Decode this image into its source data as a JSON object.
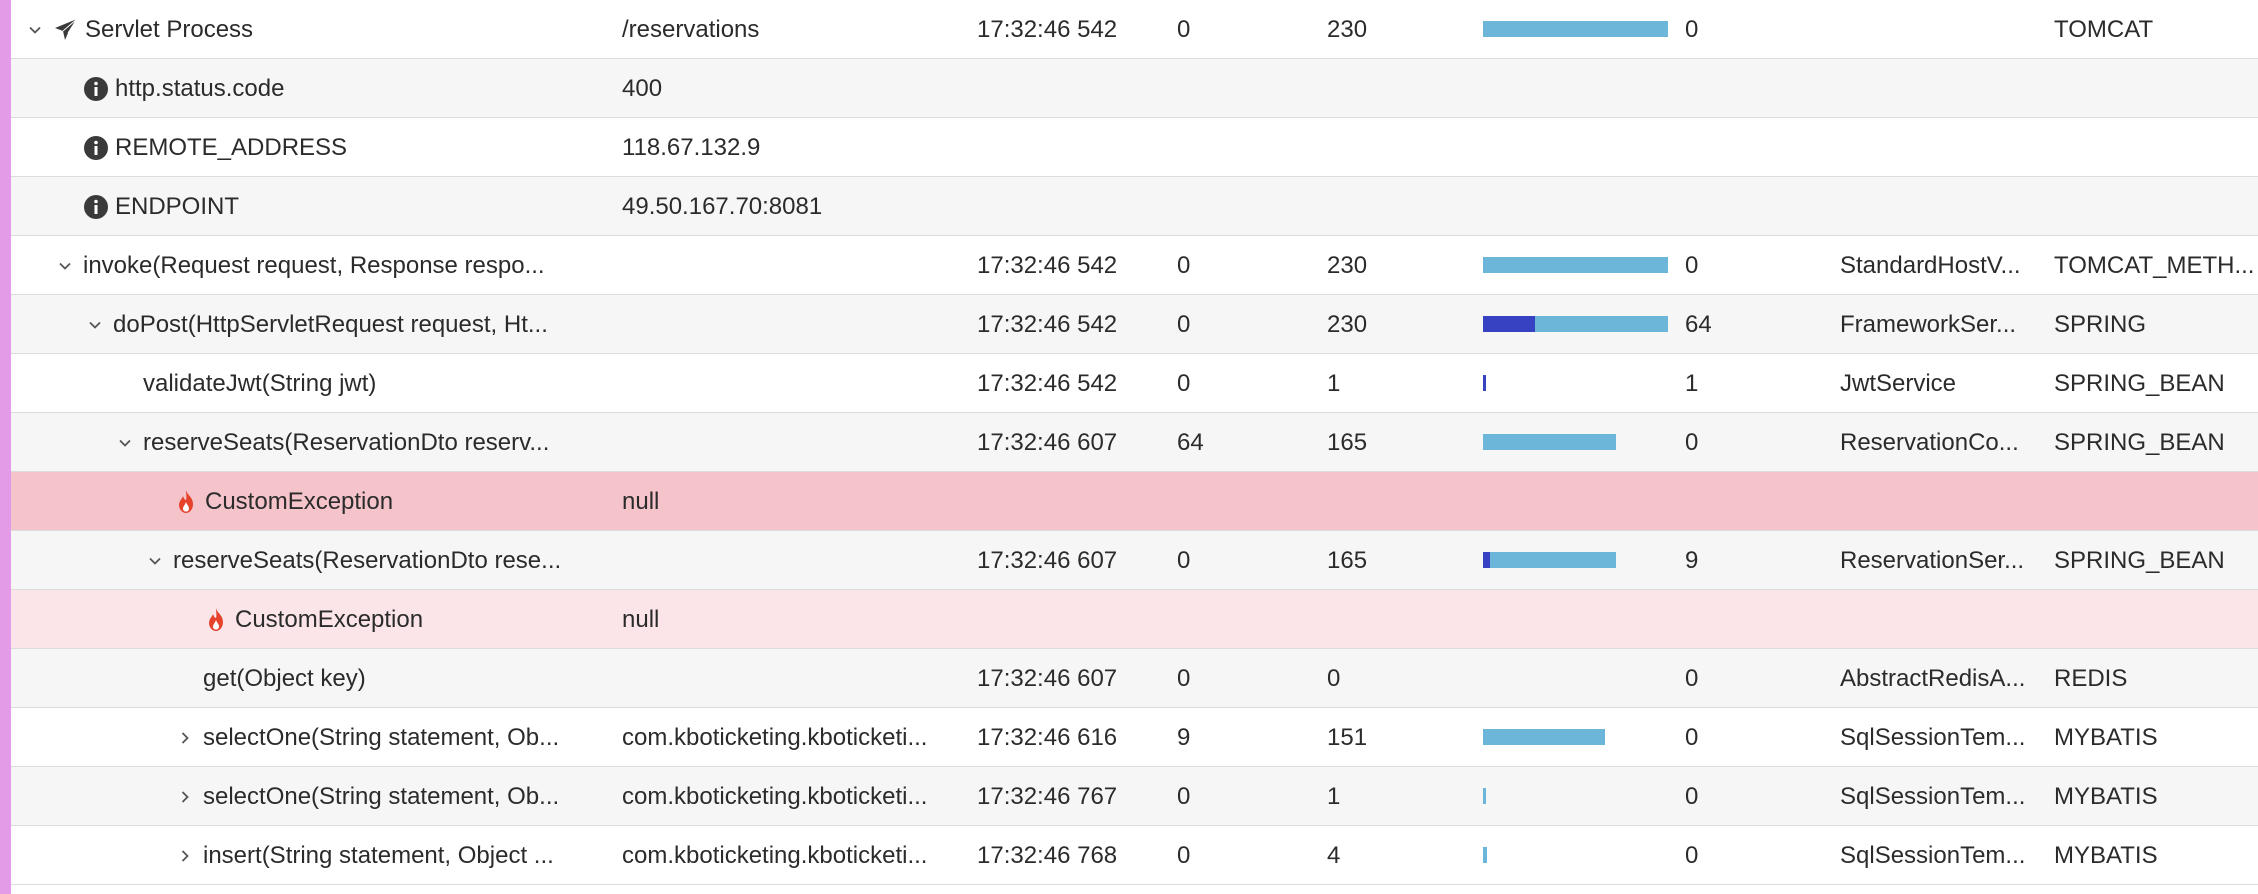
{
  "colors": {
    "left_stripe": "#e39be7",
    "bar": "#6cb6da",
    "bar_self": "#3742c2",
    "error_row": "#f5c4ca",
    "error_row_light": "#fbe5e8",
    "flame_icon": "#e5432b"
  },
  "rows": [
    {
      "name": "Servlet Process",
      "expander": "expanded",
      "icon": "paper-plane-icon",
      "depth": 0,
      "arg": "/reservations",
      "start": "17:32:46 542",
      "gap": "0",
      "elapsed": "230",
      "bar_pct": 100,
      "self_pct": 0,
      "self": "0",
      "class": "",
      "type": "TOMCAT",
      "style": "white"
    },
    {
      "name": "http.status.code",
      "expander": "none",
      "icon": "info-icon",
      "depth": 1,
      "arg": "400",
      "start": "",
      "gap": "",
      "elapsed": "",
      "bar_pct": null,
      "self_pct": null,
      "self": "",
      "class": "",
      "type": "",
      "style": "gray"
    },
    {
      "name": "REMOTE_ADDRESS",
      "expander": "none",
      "icon": "info-icon",
      "depth": 1,
      "arg": "118.67.132.9",
      "start": "",
      "gap": "",
      "elapsed": "",
      "bar_pct": null,
      "self_pct": null,
      "self": "",
      "class": "",
      "type": "",
      "style": "white"
    },
    {
      "name": "ENDPOINT",
      "expander": "none",
      "icon": "info-icon",
      "depth": 1,
      "arg": "49.50.167.70:8081",
      "start": "",
      "gap": "",
      "elapsed": "",
      "bar_pct": null,
      "self_pct": null,
      "self": "",
      "class": "",
      "type": "",
      "style": "gray"
    },
    {
      "name": "invoke(Request request, Response respo...",
      "expander": "expanded",
      "icon": "",
      "depth": 1,
      "arg": "",
      "start": "17:32:46 542",
      "gap": "0",
      "elapsed": "230",
      "bar_pct": 100,
      "self_pct": 0,
      "self": "0",
      "class": "StandardHostV...",
      "type": "TOMCAT_METH...",
      "style": "white"
    },
    {
      "name": "doPost(HttpServletRequest request, Ht...",
      "expander": "expanded",
      "icon": "",
      "depth": 2,
      "arg": "",
      "start": "17:32:46 542",
      "gap": "0",
      "elapsed": "230",
      "bar_pct": 100,
      "self_pct": 28,
      "self": "64",
      "class": "FrameworkSer...",
      "type": "SPRING",
      "style": "gray"
    },
    {
      "name": "validateJwt(String jwt)",
      "expander": "none",
      "icon": "",
      "depth": 3,
      "arg": "",
      "start": "17:32:46 542",
      "gap": "0",
      "elapsed": "1",
      "bar_pct": 1,
      "self_pct": 1,
      "self": "1",
      "class": "JwtService",
      "type": "SPRING_BEAN",
      "style": "white"
    },
    {
      "name": "reserveSeats(ReservationDto reserv...",
      "expander": "expanded",
      "icon": "",
      "depth": 3,
      "arg": "",
      "start": "17:32:46 607",
      "gap": "64",
      "elapsed": "165",
      "bar_pct": 72,
      "self_pct": 0,
      "self": "0",
      "class": "ReservationCo...",
      "type": "SPRING_BEAN",
      "style": "gray"
    },
    {
      "name": "CustomException",
      "expander": "none",
      "icon": "flame-icon",
      "depth": 4,
      "arg": "null",
      "start": "",
      "gap": "",
      "elapsed": "",
      "bar_pct": null,
      "self_pct": null,
      "self": "",
      "class": "",
      "type": "",
      "style": "err"
    },
    {
      "name": "reserveSeats(ReservationDto rese...",
      "expander": "expanded",
      "icon": "",
      "depth": 4,
      "arg": "",
      "start": "17:32:46 607",
      "gap": "0",
      "elapsed": "165",
      "bar_pct": 72,
      "self_pct": 4,
      "self": "9",
      "class": "ReservationSer...",
      "type": "SPRING_BEAN",
      "style": "gray"
    },
    {
      "name": "CustomException",
      "expander": "none",
      "icon": "flame-icon",
      "depth": 5,
      "arg": "null",
      "start": "",
      "gap": "",
      "elapsed": "",
      "bar_pct": null,
      "self_pct": null,
      "self": "",
      "class": "",
      "type": "",
      "style": "errlight"
    },
    {
      "name": "get(Object key)",
      "expander": "none",
      "icon": "",
      "depth": 5,
      "arg": "",
      "start": "17:32:46 607",
      "gap": "0",
      "elapsed": "0",
      "bar_pct": 0,
      "self_pct": 0,
      "self": "0",
      "class": "AbstractRedisA...",
      "type": "REDIS",
      "style": "gray"
    },
    {
      "name": "selectOne(String statement, Ob...",
      "expander": "collapsed",
      "icon": "",
      "depth": 5,
      "arg": "com.kboticketing.kboticketi...",
      "start": "17:32:46 616",
      "gap": "9",
      "elapsed": "151",
      "bar_pct": 66,
      "self_pct": 0,
      "self": "0",
      "class": "SqlSessionTem...",
      "type": "MYBATIS",
      "style": "white"
    },
    {
      "name": "selectOne(String statement, Ob...",
      "expander": "collapsed",
      "icon": "",
      "depth": 5,
      "arg": "com.kboticketing.kboticketi...",
      "start": "17:32:46 767",
      "gap": "0",
      "elapsed": "1",
      "bar_pct": 1,
      "self_pct": 0,
      "self": "0",
      "class": "SqlSessionTem...",
      "type": "MYBATIS",
      "style": "gray"
    },
    {
      "name": "insert(String statement, Object ...",
      "expander": "collapsed",
      "icon": "",
      "depth": 5,
      "arg": "com.kboticketing.kboticketi...",
      "start": "17:32:46 768",
      "gap": "0",
      "elapsed": "4",
      "bar_pct": 2,
      "self_pct": 0,
      "self": "0",
      "class": "SqlSessionTem...",
      "type": "MYBATIS",
      "style": "white"
    }
  ]
}
